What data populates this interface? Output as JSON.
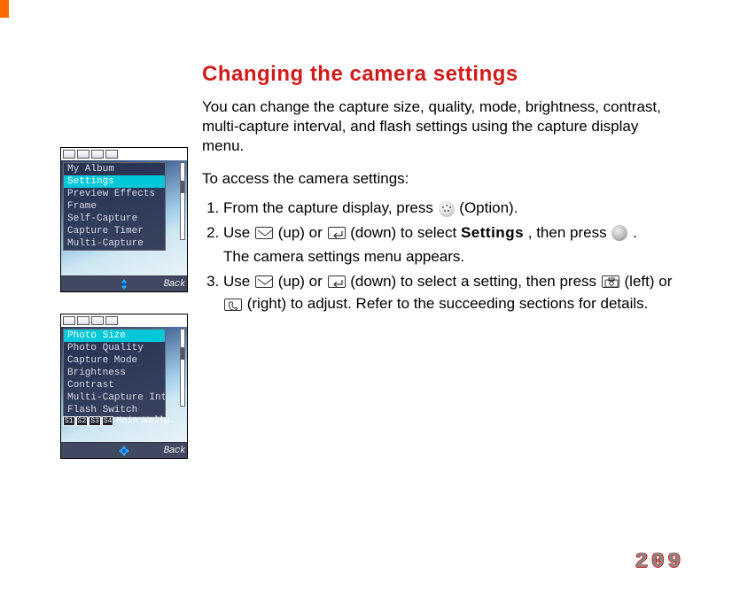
{
  "heading": "Changing the camera settings",
  "intro": "You can change the capture size, quality, mode, brightness, contrast, multi-capture interval, and flash settings using the capture display menu.",
  "subhead": "To access the camera settings:",
  "steps": {
    "s1_a": "From the capture display, press ",
    "s1_b": " (Option).",
    "s2_a": "Use ",
    "s2_b": " (up) or ",
    "s2_c": " (down) to select ",
    "s2_bold": "Settings",
    "s2_d": ", then press ",
    "s2_e": ".",
    "s2_sub": "The camera settings menu appears.",
    "s3_a": "Use ",
    "s3_b": " (up) or ",
    "s3_c": " (down) to select a setting, then press ",
    "s3_d": " (left) or ",
    "s3_e": " (right) to adjust. Refer to the succeeding sections for details."
  },
  "shot1": {
    "items": [
      "My Album",
      "Settings",
      "Preview Effects",
      "Frame",
      "Self-Capture",
      "Capture Timer",
      "Multi-Capture"
    ],
    "selected": 1,
    "soft_right": "Back"
  },
  "shot2": {
    "items": [
      "Photo Size",
      "Photo Quality",
      "Capture Mode",
      "Brightness",
      "Contrast",
      "Multi-Capture Int",
      "Flash Switch"
    ],
    "selected": 0,
    "bottom_tags": [
      "S1",
      "S2",
      "S3",
      "S4"
    ],
    "bottom_text": "Main Wallp.",
    "soft_right": "Back"
  },
  "page_number": "209"
}
